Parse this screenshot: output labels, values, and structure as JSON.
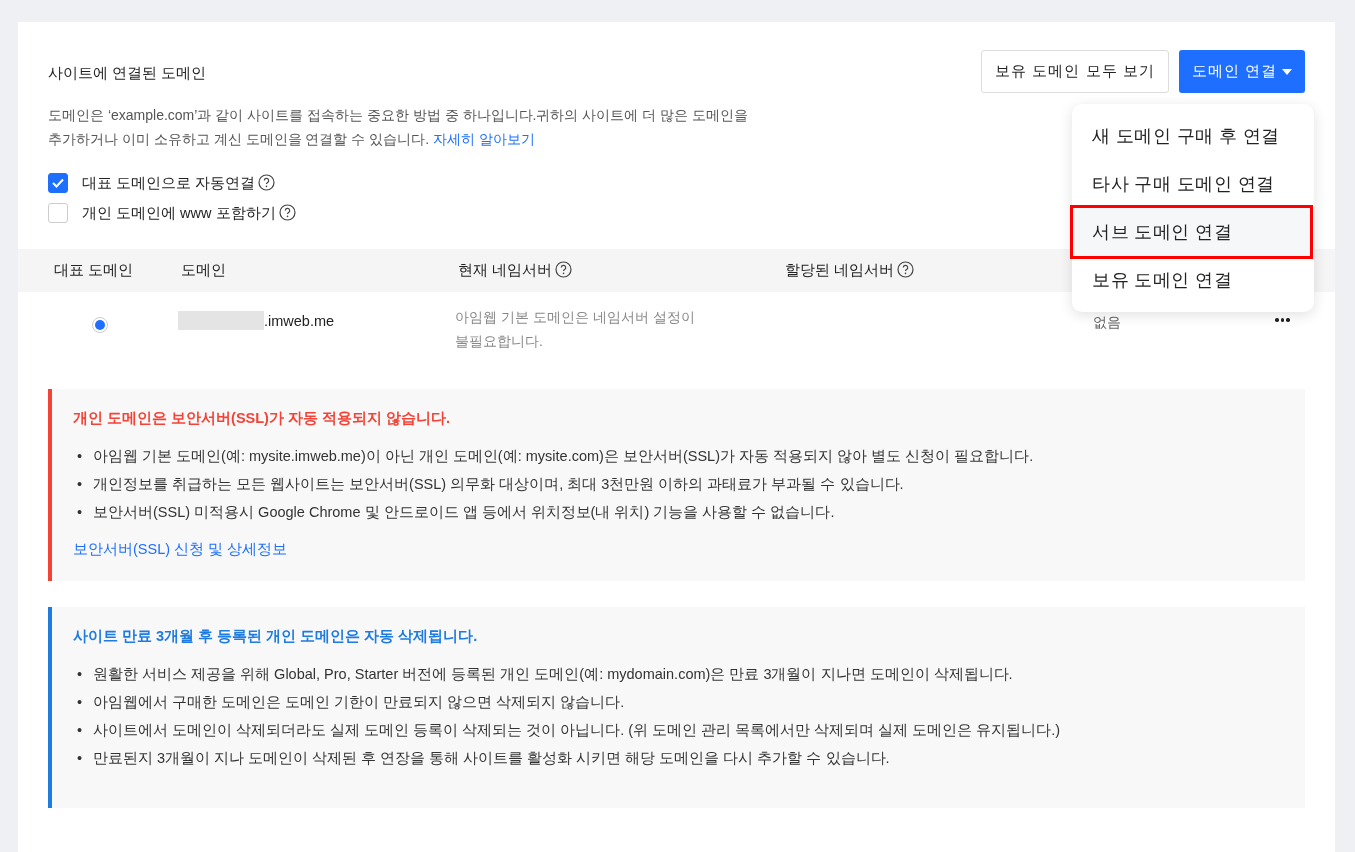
{
  "section": {
    "title": "사이트에 연결된 도메인",
    "description": "도메인은 ‘example.com’과 같이 사이트를 접속하는 중요한 방법 중 하나입니다.귀하의 사이트에 더 많은 도메인을 추가하거나 이미 소유하고 계신 도메인을 연결할 수 있습니다.",
    "link": "자세히 알아보기"
  },
  "buttons": [
    {
      "label": "보유 도메인 모두 보기",
      "kind": "outline"
    },
    {
      "label": "도메인 연결",
      "kind": "primary"
    }
  ],
  "connect_menu": {
    "expanded": true,
    "items": [
      {
        "label": "새 도메인 구매 후 연결",
        "selected": false
      },
      {
        "label": "타사 구매 도메인 연결",
        "selected": false
      },
      {
        "label": "서브 도메인 연결",
        "selected": true
      },
      {
        "label": "보유 도메인 연결",
        "selected": false
      }
    ]
  },
  "options": [
    {
      "label": "대표 도메인으로 자동연결",
      "checked": true
    },
    {
      "label": "개인 도메인에 www 포함하기",
      "checked": false
    }
  ],
  "table": {
    "columns": [
      {
        "label": "대표 도메인",
        "help": false
      },
      {
        "label": "도메인",
        "help": false
      },
      {
        "label": "현재 네임서버",
        "help": true
      },
      {
        "label": "할당된 네임서버",
        "help": true
      }
    ],
    "rows": [
      {
        "primary": true,
        "redacted": true,
        "domain": ".imweb.me",
        "current_nameserver": "아임웹 기본 도메인은 네임서버 설정이 불필요합니다.",
        "column_5": "없음"
      }
    ]
  },
  "notices": [
    {
      "kind": "warning",
      "bullet": "•",
      "title": "개인 도메인은 보안서버(SSL)가 자동 적용되지 않습니다.",
      "items": [
        "아임웹 기본 도메인(예: mysite.imweb.me)이 아닌 개인 도메인(예: mysite.com)은 보안서버(SSL)가 자동 적용되지 않아 별도 신청이 필요합니다.",
        "개인정보를 취급하는 모든 웹사이트는 보안서버(SSL) 의무화 대상이며, 최대 3천만원 이하의 과태료가 부과될 수 있습니다.",
        "보안서버(SSL) 미적용시 Google Chrome 및 안드로이드 앱 등에서 위치정보(내 위치) 기능을 사용할 수 없습니다."
      ],
      "link": "보안서버(SSL) 신청 및 상세정보"
    },
    {
      "kind": "info",
      "bullet": "•",
      "title": "사이트 만료 3개월 후 등록된 개인 도메인은 자동 삭제됩니다.",
      "items": [
        "원활한 서비스 제공을 위해 Global, Pro, Starter 버전에 등록된 개인 도메인(예: mydomain.com)은 만료 3개월이 지나면 도메인이 삭제됩니다.",
        "아임웹에서 구매한 도메인은 도메인 기한이 만료되지 않으면 삭제되지 않습니다.",
        "사이트에서 도메인이 삭제되더라도 실제 도메인 등록이 삭제되는 것이 아닙니다. (위 도메인 관리 목록에서만 삭제되며 실제 도메인은 유지됩니다.)",
        "만료된지 3개월이 지나 도메인이 삭제된 후 연장을 통해 사이트를 활성화 시키면 해당 도메인을 다시 추가할 수 있습니다."
      ]
    }
  ]
}
